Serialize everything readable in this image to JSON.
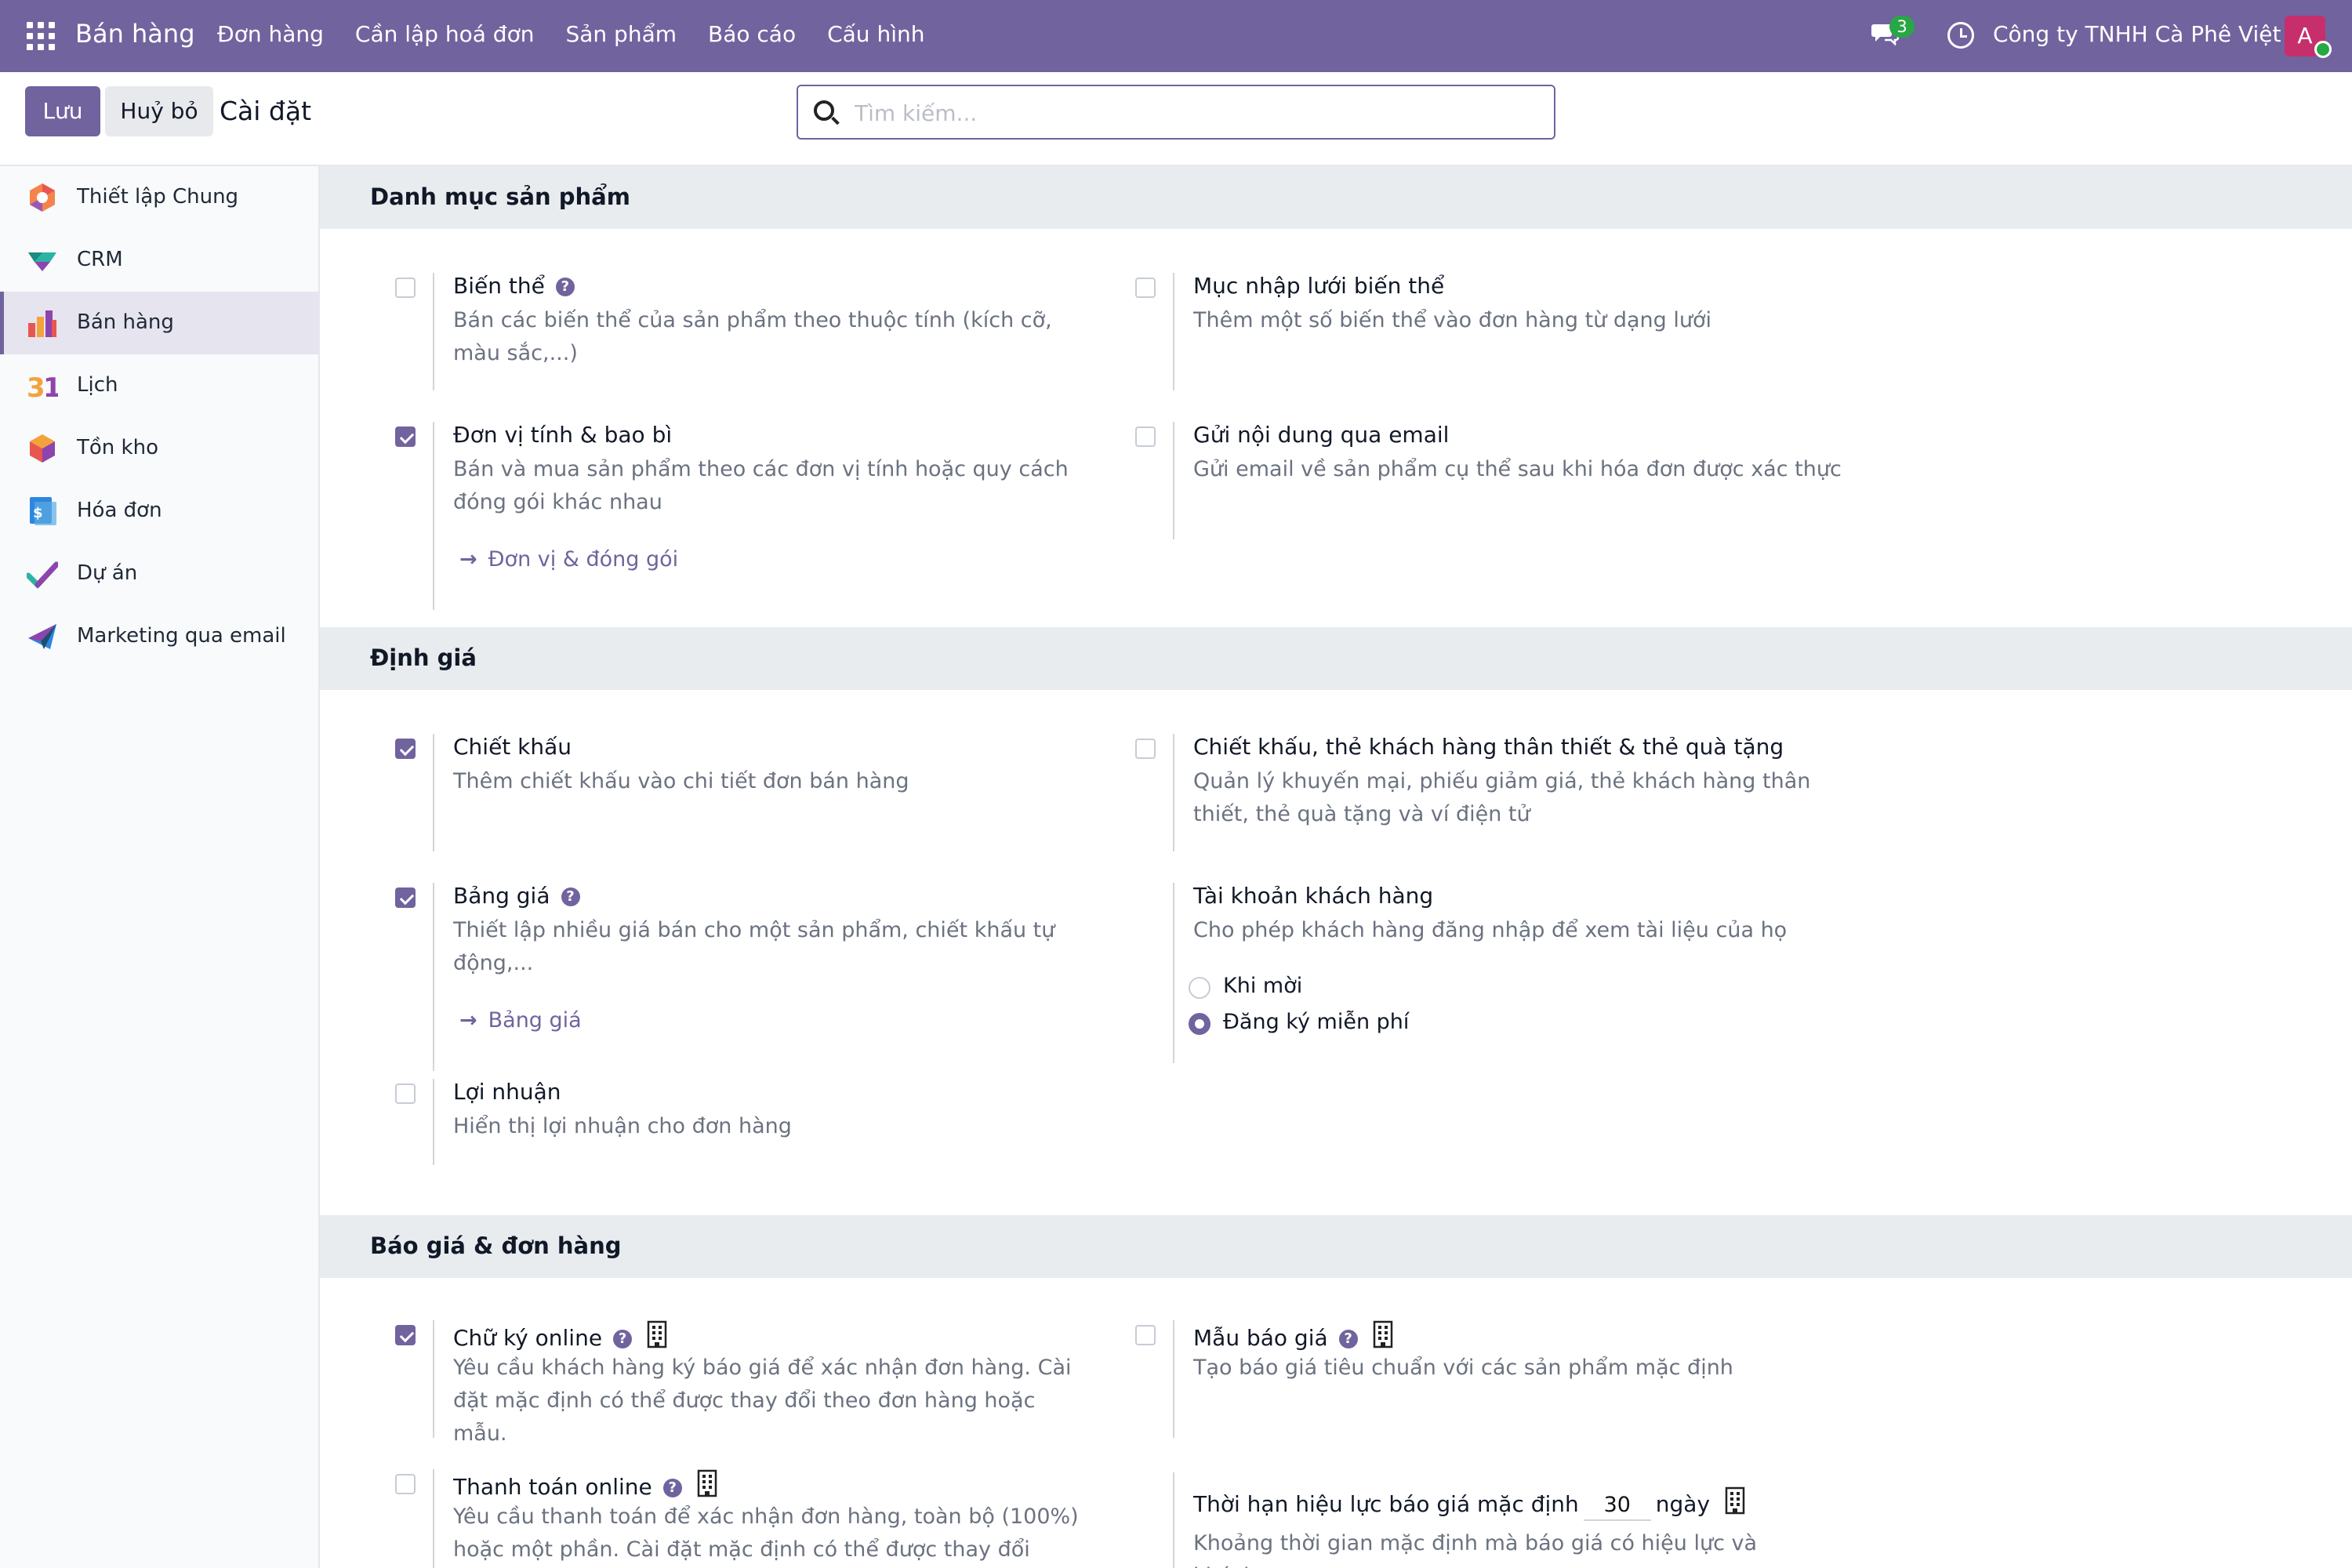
{
  "navbar": {
    "brand": "Bán hàng",
    "menu": [
      "Đơn hàng",
      "Cần lập hoá đơn",
      "Sản phẩm",
      "Báo cáo",
      "Cấu hình"
    ],
    "chat_badge": "3",
    "company": "Công ty TNHH Cà Phê Việt",
    "avatar_letter": "A"
  },
  "control": {
    "save_label": "Lưu",
    "cancel_label": "Huỷ bỏ",
    "title": "Cài đặt",
    "search_placeholder": "Tìm kiếm..."
  },
  "sidebar": {
    "items": [
      {
        "label": "Thiết lập Chung",
        "icon": "general-settings-icon"
      },
      {
        "label": "CRM",
        "icon": "crm-icon"
      },
      {
        "label": "Bán hàng",
        "icon": "sales-icon",
        "active": true
      },
      {
        "label": "Lịch",
        "icon": "calendar-icon"
      },
      {
        "label": "Tồn kho",
        "icon": "inventory-icon"
      },
      {
        "label": "Hóa đơn",
        "icon": "invoicing-icon"
      },
      {
        "label": "Dự án",
        "icon": "project-icon"
      },
      {
        "label": "Marketing qua email",
        "icon": "email-marketing-icon"
      }
    ]
  },
  "sections": {
    "catalog": {
      "title": "Danh mục sản phẩm",
      "variants": {
        "title": "Biến thể",
        "desc": "Bán các biến thể của sản phẩm theo thuộc tính (kích cỡ, màu sắc,...)",
        "checked": false
      },
      "grid_entry": {
        "title": "Mục nhập lưới biến thể",
        "desc": "Thêm một số biến thể vào đơn hàng từ dạng lưới",
        "checked": false
      },
      "uom": {
        "title": "Đơn vị tính & bao bì",
        "desc": "Bán và mua sản phẩm theo các đơn vị tính hoặc quy cách đóng gói khác nhau",
        "link": "Đơn vị & đóng gói",
        "checked": true
      },
      "email_content": {
        "title": "Gửi nội dung qua email",
        "desc": "Gửi email về sản phẩm cụ thể sau khi hóa đơn được xác thực",
        "checked": false
      }
    },
    "pricing": {
      "title": "Định giá",
      "discounts": {
        "title": "Chiết khấu",
        "desc": "Thêm chiết khấu vào chi tiết đơn bán hàng",
        "checked": true
      },
      "loyalty": {
        "title": "Chiết khấu, thẻ khách hàng thân thiết & thẻ quà tặng",
        "desc": "Quản lý khuyến mại, phiếu giảm giá, thẻ khách hàng thân thiết, thẻ quà tặng và ví điện tử",
        "checked": false
      },
      "pricelists": {
        "title": "Bảng giá",
        "desc": "Thiết lập nhiều giá bán cho một sản phẩm, chiết khấu tự động,...",
        "link": "Bảng giá",
        "checked": true
      },
      "customer_account": {
        "title": "Tài khoản khách hàng",
        "desc": "Cho phép khách hàng đăng nhập để xem tài liệu của họ",
        "options": [
          "Khi mời",
          "Đăng ký miễn phí"
        ],
        "selected": 1
      },
      "margins": {
        "title": "Lợi nhuận",
        "desc": "Hiển thị lợi nhuận cho đơn hàng",
        "checked": false
      }
    },
    "quotations": {
      "title": "Báo giá & đơn hàng",
      "online_signature": {
        "title": "Chữ ký online",
        "desc": "Yêu cầu khách hàng ký báo giá để xác nhận đơn hàng. Cài đặt mặc định có thể được thay đổi theo đơn hàng hoặc mẫu.",
        "checked": true
      },
      "quote_templates": {
        "title": "Mẫu báo giá",
        "desc": "Tạo báo giá tiêu chuẩn với các sản phẩm mặc định",
        "checked": false
      },
      "online_payment": {
        "title": "Thanh toán online",
        "desc": "Yêu cầu thanh toán để xác nhận đơn hàng, toàn bộ (100%) hoặc một phần. Cài đặt mặc định có thể được thay đổi theo",
        "checked": false
      },
      "validity": {
        "title": "Thời hạn hiệu lực báo giá mặc định",
        "value": "30",
        "unit": "ngày",
        "desc": "Khoảng thời gian mặc định mà báo giá có hiệu lực và khách"
      }
    }
  },
  "colors": {
    "brand": "#71639e",
    "header_bg": "#e9ecef",
    "badge": "#28a745"
  }
}
